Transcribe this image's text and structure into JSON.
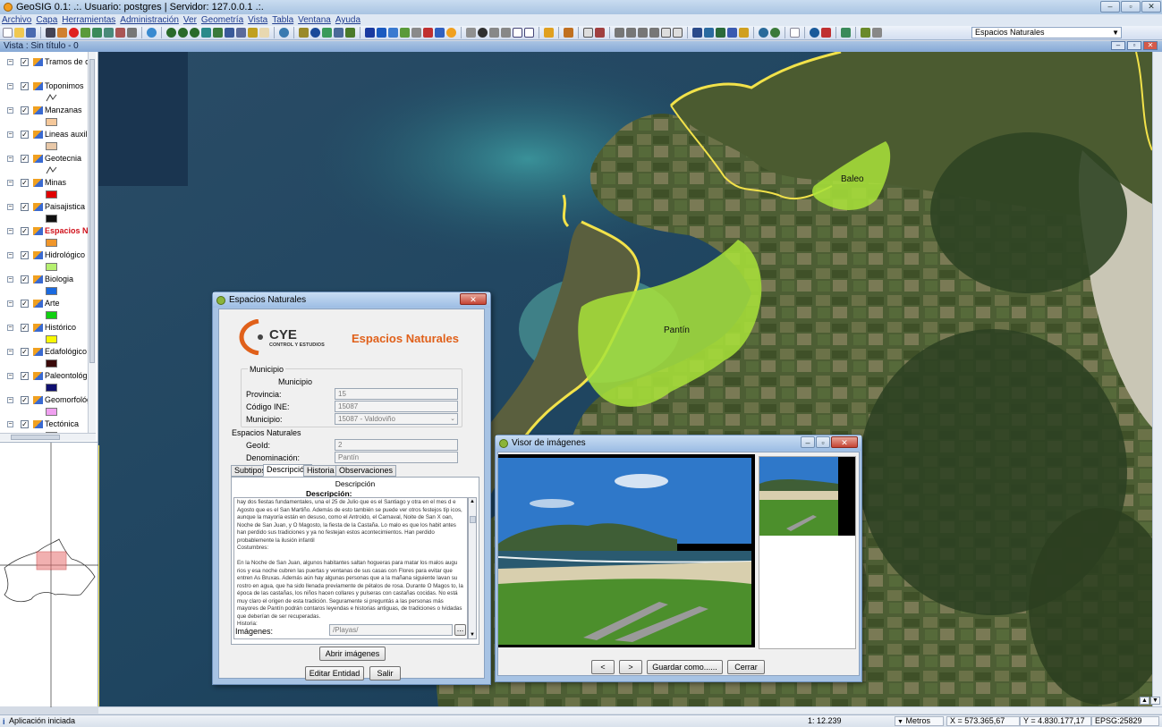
{
  "app": {
    "title": "GeoSIG 0.1: .:. Usuario: postgres | Servidor: 127.0.0.1 .:.",
    "window_controls": [
      "–",
      "▫",
      "✕"
    ]
  },
  "menu": [
    "Archivo",
    "Capa",
    "Herramientas",
    "Administración",
    "Ver",
    "Geometría",
    "Vista",
    "Tabla",
    "Ventana",
    "Ayuda"
  ],
  "toolbar": {
    "layer_combo": "Espacios Naturales"
  },
  "vista": {
    "title": "Vista : Sin título - 0"
  },
  "toc": {
    "layers": [
      {
        "label": "Tramos de car",
        "sym": "none",
        "color": "#ffffff"
      },
      {
        "label": "Toponimos",
        "sym": "line",
        "color": "#3a3a3a"
      },
      {
        "label": "Manzanas",
        "sym": "fill",
        "color": "#f5c89a"
      },
      {
        "label": "Lineas auxiliar",
        "sym": "fill",
        "color": "#e8c8a8"
      },
      {
        "label": "Geotecnia",
        "sym": "line",
        "color": "#3a3a3a"
      },
      {
        "label": "Minas",
        "sym": "fill",
        "color": "#e00000"
      },
      {
        "label": "Paisajistica",
        "sym": "fill",
        "color": "#101010"
      },
      {
        "label": "Espacios N",
        "sym": "fill",
        "color": "#f0962a"
      },
      {
        "label": "Hidrológico",
        "sym": "fill",
        "color": "#b6f070"
      },
      {
        "label": "Biologia",
        "sym": "fill",
        "color": "#1a6ae0"
      },
      {
        "label": "Arte",
        "sym": "fill",
        "color": "#10d010"
      },
      {
        "label": "Histórico",
        "sym": "fill",
        "color": "#f8f800"
      },
      {
        "label": "Edafológico",
        "sym": "fill",
        "color": "#3a0a0a"
      },
      {
        "label": "Paleontológico",
        "sym": "fill",
        "color": "#101070"
      },
      {
        "label": "Geomorfológic",
        "sym": "fill",
        "color": "#f0a0f0"
      },
      {
        "label": "Tectónica",
        "sym": "fill",
        "color": "#6a3a10"
      }
    ]
  },
  "map": {
    "labels": [
      "Baleo",
      "Pantín"
    ]
  },
  "status": {
    "message": "Aplicación iniciada",
    "scale": "1: 12.239",
    "units": "Metros",
    "x": "X = 573.365,67",
    "y": "Y = 4.830.177,17",
    "epsg": "EPSG:25829"
  },
  "dialog": {
    "title": "Espacios Naturales",
    "logo_text": "CYE",
    "logo_sub": "CONTROL Y ESTUDIOS",
    "header": "Espacios Naturales",
    "municipio_group": "Municipio",
    "municipio_sub": "Municipio",
    "provincia_label": "Provincia:",
    "provincia_value": "15",
    "codigo_label": "Código INE:",
    "codigo_value": "15087",
    "municipio_label": "Municipio:",
    "municipio_value": "15087 - Valdoviño",
    "espacios_group": "Espacios Naturales",
    "geoid_label": "GeoId:",
    "geoid_value": "2",
    "denominacion_label": "Denominación:",
    "denominacion_value": "Pantín",
    "tabs": [
      "Subtipos",
      "Descripción",
      "Historia",
      "Observaciones"
    ],
    "desc_header": "Descripción",
    "desc_label": "Descripción:",
    "desc_text": "hay dos fiestas fundamentales, una el 25 de Julio que es el Santiago y otra en el mes d e Agosto que es el San Martiño. Además de esto también se puede ver otros festejos típ icos, aunque la mayoría están en desuso, como el Antroido, el Carnaval, Noite de San X oan, Noche de San Juan, y O Magosto, la fiesta de la Castaña. Lo malo es que los habit antes han perdido sus tradiciones y ya no festejan estos acontecimientos. Han perdido probablemente la ilusión infantil\nCostumbres:\n\nEn la Noche de San Juan, algunos habitantes saltan hogueras para matar los malos augu rios y esa noche cubren las puertas y ventanas de sus casas con Flores para evitar que entren As Bruxas. Además aún hay algunas personas que a la mañana siguiente lavan su rostro en agua, que ha sido llenada previamente de pétalos de rosa. Durante O Magos to, la época de las castañas, los niños hacen collares y pulseras con castañas cocidas. No está muy claro el origen de esta tradición. Seguramente si preguntás a las personas más mayores de Pantín podrán contaros leyendas e historias antiguas, de tradiciones o lvidadas que deberían de ser recuperadas.\nHistoria:",
    "imagenes_label": "Imágenes:",
    "imagenes_value": "/Playas/",
    "browse_label": "...",
    "abrir_label": "Abrir imágenes",
    "editar_label": "Editar Entidad",
    "salir_label": "Salir"
  },
  "viewer": {
    "title": "Visor de imágenes",
    "prev_label": "<",
    "next_label": ">",
    "save_label": "Guardar como......",
    "close_label": "Cerrar"
  }
}
